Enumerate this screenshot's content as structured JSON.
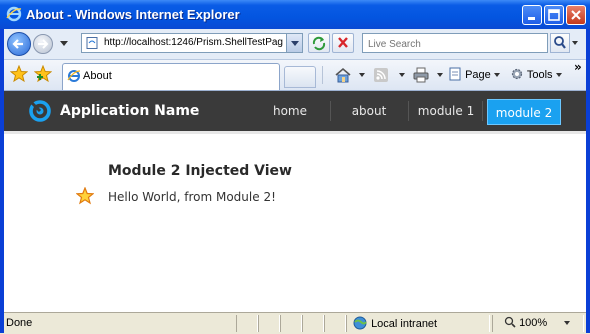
{
  "window": {
    "title": "About - Windows Internet Explorer"
  },
  "navbar": {
    "url": "http://localhost:1246/Prism.ShellTestPag",
    "search_placeholder": "Live Search"
  },
  "tabs": [
    {
      "label": "About"
    }
  ],
  "command_bar": {
    "page_label": "Page",
    "tools_label": "Tools",
    "chevron": "»"
  },
  "app": {
    "name": "Application Name",
    "nav": [
      {
        "label": "home",
        "active": false
      },
      {
        "label": "about",
        "active": false
      },
      {
        "label": "module 1",
        "active": false
      },
      {
        "label": "module 2",
        "active": true
      }
    ],
    "accent_color": "#1aa1f0"
  },
  "content": {
    "title": "Module 2 Injected View",
    "message": "Hello World, from Module 2!"
  },
  "status": {
    "text": "Done",
    "zone": "Local intranet",
    "zoom": "100%"
  }
}
